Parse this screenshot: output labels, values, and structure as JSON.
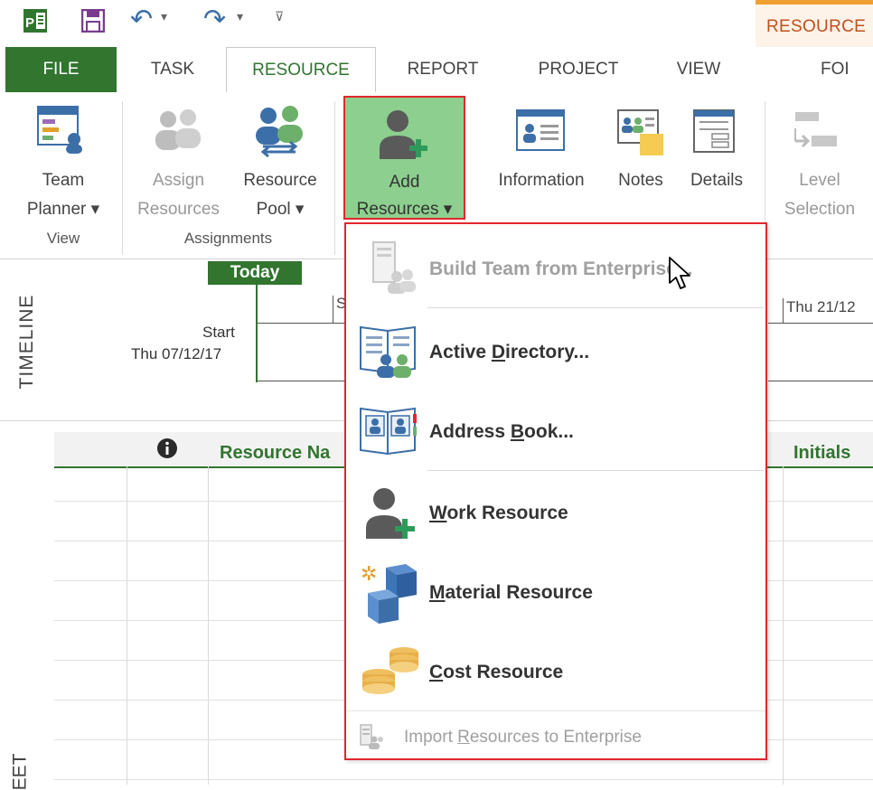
{
  "qat": {
    "undo_glyph": "↶",
    "redo_glyph": "↷",
    "more_glyph": "▾"
  },
  "context_tab": {
    "label": "RESOURCE"
  },
  "tabs": [
    {
      "label": "FILE"
    },
    {
      "label": "TASK"
    },
    {
      "label": "RESOURCE"
    },
    {
      "label": "REPORT"
    },
    {
      "label": "PROJECT"
    },
    {
      "label": "VIEW"
    },
    {
      "label": "FOI"
    }
  ],
  "ribbon": {
    "team_planner": {
      "line1": "Team",
      "line2": "Planner ▾"
    },
    "assign_resources": {
      "line1": "Assign",
      "line2": "Resources"
    },
    "resource_pool": {
      "line1": "Resource",
      "line2": "Pool ▾"
    },
    "add_resources": {
      "line1": "Add",
      "line2": "Resources ▾"
    },
    "information": {
      "label": "Information"
    },
    "notes": {
      "label": "Notes"
    },
    "details": {
      "label": "Details"
    },
    "level_selection": {
      "line1": "Level",
      "line2": "Selection"
    },
    "groups": {
      "view": "View",
      "assignments": "Assignments"
    }
  },
  "timeline": {
    "side_label": "TIMELINE",
    "today": "Today",
    "start_label": "Start",
    "start_date": "Thu 07/12/17",
    "partial_tick": "S",
    "right_date": "Thu 21/12"
  },
  "sheet": {
    "columns": [
      "Resource Na",
      "Initials"
    ],
    "side_label": "EET",
    "info_glyph": "i"
  },
  "dropdown": {
    "items": [
      {
        "label": "Build Team from Enterprise...",
        "enabled": false,
        "icon": "build-team-icon"
      },
      {
        "label_pre": "Active ",
        "label_u": "D",
        "label_post": "irectory...",
        "enabled": true,
        "icon": "active-directory-icon"
      },
      {
        "label_pre": "Address ",
        "label_u": "B",
        "label_post": "ook...",
        "enabled": true,
        "icon": "address-book-icon"
      },
      {
        "label_u": "W",
        "label_post": "ork Resource",
        "enabled": true,
        "icon": "work-resource-icon"
      },
      {
        "label_u": "M",
        "label_post": "aterial Resource",
        "enabled": true,
        "icon": "material-resource-icon"
      },
      {
        "label_u": "C",
        "label_post": "ost Resource",
        "enabled": true,
        "icon": "cost-resource-icon"
      },
      {
        "label_pre": "Import ",
        "label_u": "R",
        "label_post": "esources to Enterprise",
        "enabled": false,
        "icon": "import-resources-icon"
      }
    ]
  },
  "colors": {
    "file_tab": "#31752f",
    "highlight_green": "#8ccf8e",
    "callout_red": "#e2262c",
    "context_orange": "#f0a030",
    "text": "#444444"
  }
}
